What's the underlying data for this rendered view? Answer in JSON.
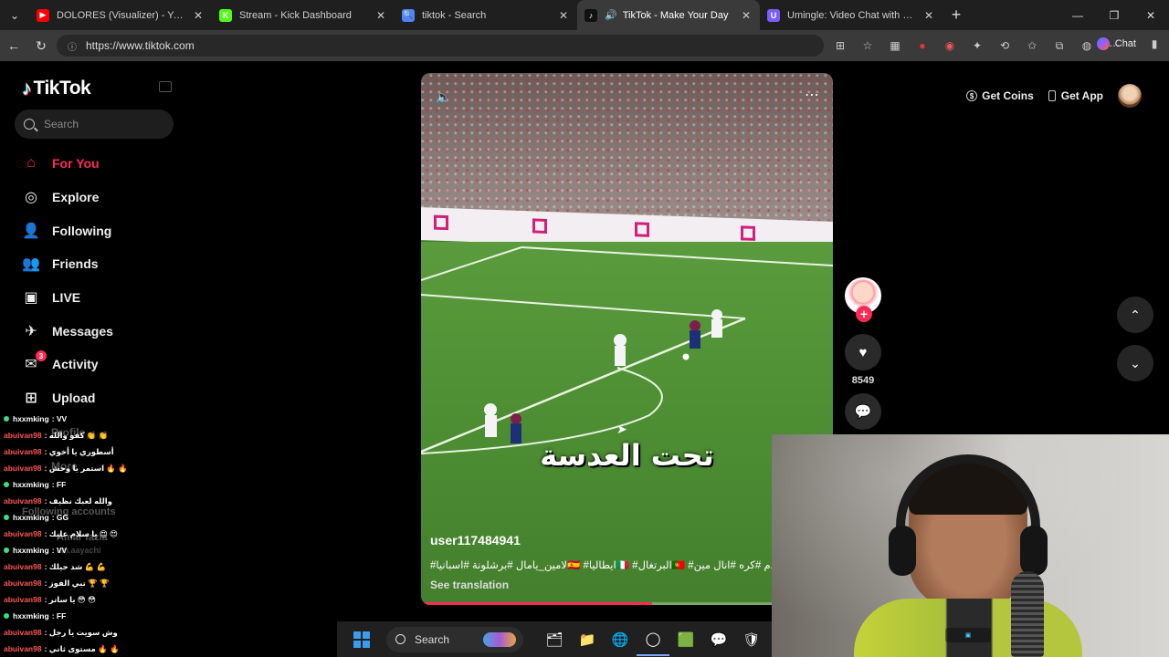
{
  "browser": {
    "tabs": [
      {
        "title": "DOLORES (Visualizer) - YouTube",
        "color": "#ff0000",
        "glyph": "▶"
      },
      {
        "title": "Stream - Kick Dashboard",
        "color": "#53fc18",
        "glyph": "K"
      },
      {
        "title": "tiktok - Search",
        "color": "#4f83ff",
        "glyph": "🔍"
      },
      {
        "title": "TikTok - Make Your Day",
        "color": "#111111",
        "glyph": "♪",
        "active": true
      },
      {
        "title": "Umingle: Video Chat with Stra",
        "color": "#7b5cff",
        "glyph": "U"
      }
    ],
    "url": "https://www.tiktok.com",
    "chat_label": "Chat"
  },
  "sidebar": {
    "logo_text": "TikTok",
    "search_placeholder": "Search",
    "nav": [
      {
        "label": "For You",
        "icon": "⌂",
        "active": true
      },
      {
        "label": "Explore",
        "icon": "◎"
      },
      {
        "label": "Following",
        "icon": "👤"
      },
      {
        "label": "Friends",
        "icon": "👥"
      },
      {
        "label": "LIVE",
        "icon": "▣"
      },
      {
        "label": "Messages",
        "icon": "✈"
      },
      {
        "label": "Activity",
        "icon": "✉",
        "badge": "3"
      },
      {
        "label": "Upload",
        "icon": "⊞"
      }
    ],
    "ghost": {
      "profile": "Profile",
      "more": "More",
      "following_accounts": "Following accounts",
      "account_name": "Amar fazia",
      "account_handle": "am.aayachi"
    }
  },
  "chat_overlay": [
    {
      "user": "hxxmking",
      "msg": ": VV",
      "type": "mod"
    },
    {
      "user": "abuivan98",
      "msg": ": كفو والله 👏 👏",
      "type": "red"
    },
    {
      "user": "abuivan98",
      "msg": ": أسطوري يا أخوي",
      "type": "red"
    },
    {
      "user": "abuivan98",
      "msg": ": استمر يا وحش 🔥 🔥",
      "type": "red"
    },
    {
      "user": "hxxmking",
      "msg": ": FF",
      "type": "mod"
    },
    {
      "user": "abuivan98",
      "msg": ": والله لعبك نظيف",
      "type": "red"
    },
    {
      "user": "hxxmking",
      "msg": ": GG",
      "type": "mod"
    },
    {
      "user": "abuivan98",
      "msg": ": يا سلام عليك 😍 😍",
      "type": "red"
    },
    {
      "user": "hxxmking",
      "msg": ": VV",
      "type": "mod"
    },
    {
      "user": "abuivan98",
      "msg": ": شد حيلك 💪 💪",
      "type": "red"
    },
    {
      "user": "abuivan98",
      "msg": ": تبي الفوز 🏆 🏆",
      "type": "red"
    },
    {
      "user": "abuivan98",
      "msg": ": يا ساتر 😳 😳",
      "type": "red"
    },
    {
      "user": "hxxmking",
      "msg": ": FF",
      "type": "mod"
    },
    {
      "user": "abuivan98",
      "msg": ": وش سويت يا رجل",
      "type": "red"
    },
    {
      "user": "abuivan98",
      "msg": ": مستوى ثاني 🔥 🔥",
      "type": "red"
    }
  ],
  "video": {
    "caption_overlay": "تحت العدسة",
    "username": "user117484941",
    "tags": "#لامين_يامال #برشلونة #اسبانيا🇪🇸 #ايطاليا🇮🇹 #البرتغال🇵🇹 #كرة_قدم #كره #انال مين",
    "see_translation": "See translation",
    "progress": 0.56,
    "like_count": "8549"
  },
  "topright": {
    "get_coins": "Get Coins",
    "get_app": "Get App"
  },
  "taskbar": {
    "search_label": "Search",
    "apps": [
      "🗂",
      "📁",
      "🌐",
      "◯",
      "🟩",
      "💬",
      "🛡"
    ]
  }
}
